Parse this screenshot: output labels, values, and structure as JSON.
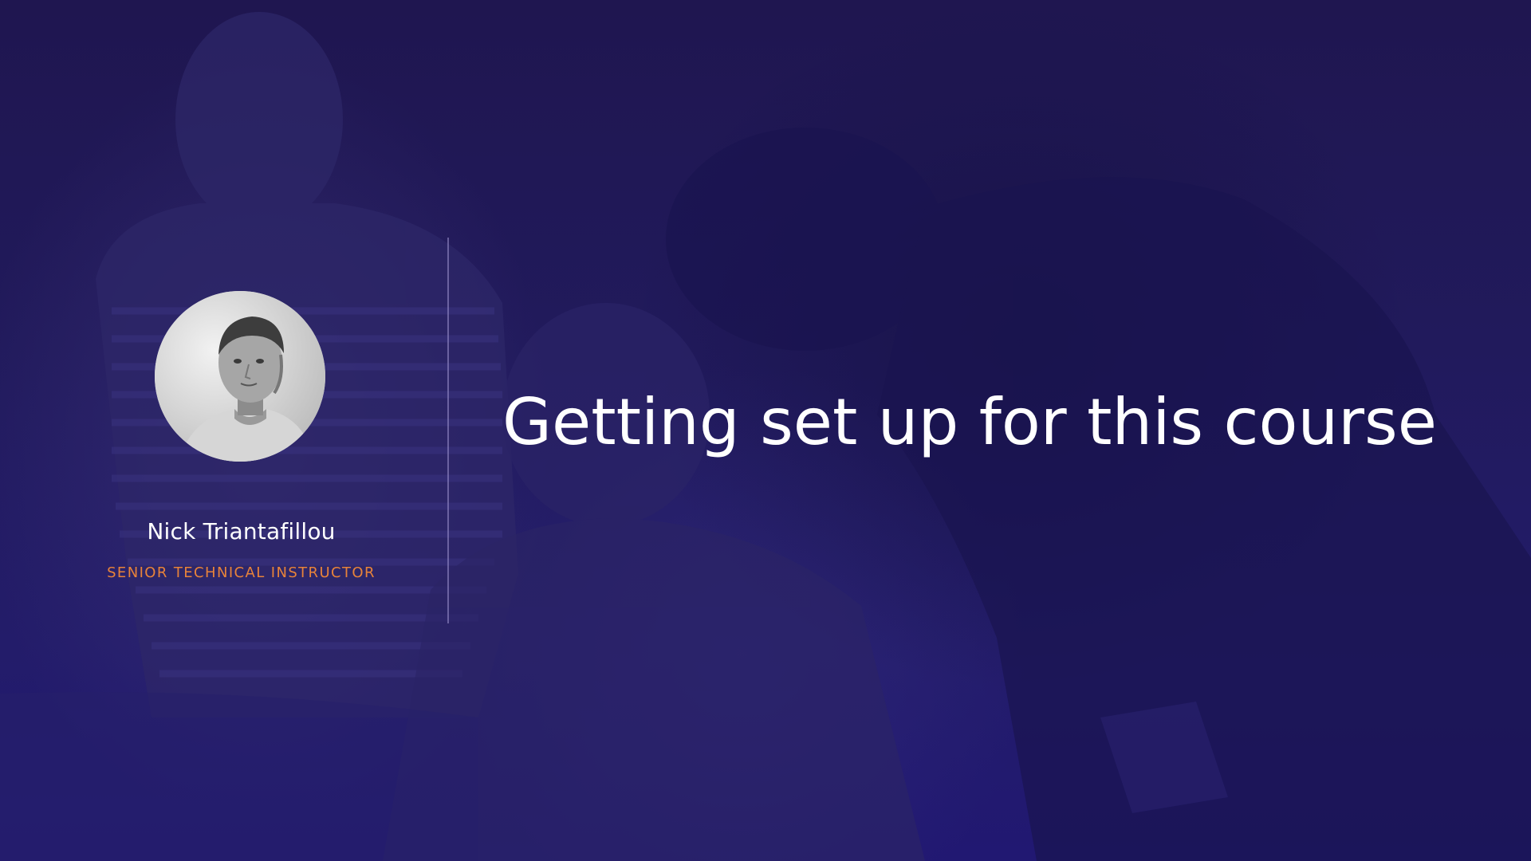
{
  "slide": {
    "title": "Getting set up for this course",
    "instructor": {
      "name": "Nick Triantafillou",
      "role": "SENIOR TECHNICAL INSTRUCTOR"
    }
  },
  "colors": {
    "background": "#211a5c",
    "title_text": "#ffffff",
    "name_text": "#ffffff",
    "role_text": "#e8833a",
    "divider": "#968cc8"
  },
  "icons": {
    "avatar": "instructor-photo"
  }
}
